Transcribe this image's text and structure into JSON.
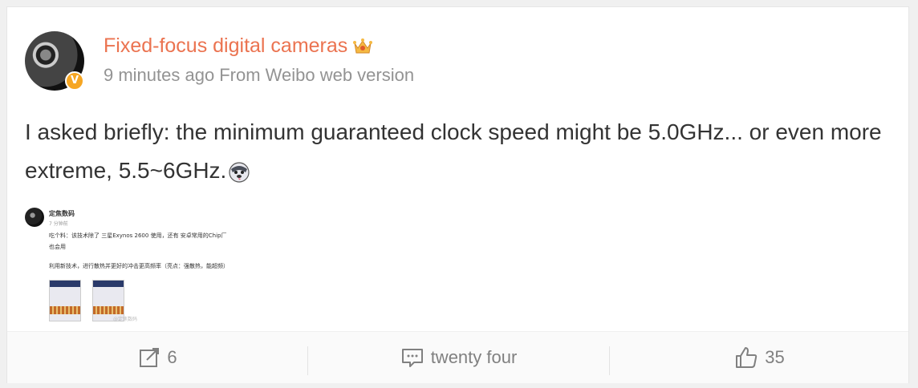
{
  "post": {
    "author": "Fixed-focus digital cameras",
    "time": "9 minutes ago",
    "source": "From Weibo web version",
    "verified_badge": "V",
    "text": "I asked briefly: the minimum guaranteed clock speed might be 5.0GHz... or even more extreme, 5.5~6GHz.",
    "author_color": "#eb7350"
  },
  "embedded": {
    "author": "定焦数码",
    "time": "7 分钟前",
    "line1": "吃个料：该技术除了 三星Exynos 2600 使用，还有 安卓常用的Chip厂",
    "line2": "也会用",
    "line3": "利用新技术，进行散热并更好的冲击更高频率（亮点：强散热，能超频）",
    "watermark": "@定焦数码"
  },
  "actions": {
    "repost_count": "6",
    "comment_count": "twenty four",
    "like_count": "35"
  },
  "icons": {
    "crown": "crown-badge-icon",
    "emoji": "husky-emoji-icon",
    "repost": "repost-icon",
    "comment": "comment-icon",
    "like": "thumbs-up-icon"
  }
}
